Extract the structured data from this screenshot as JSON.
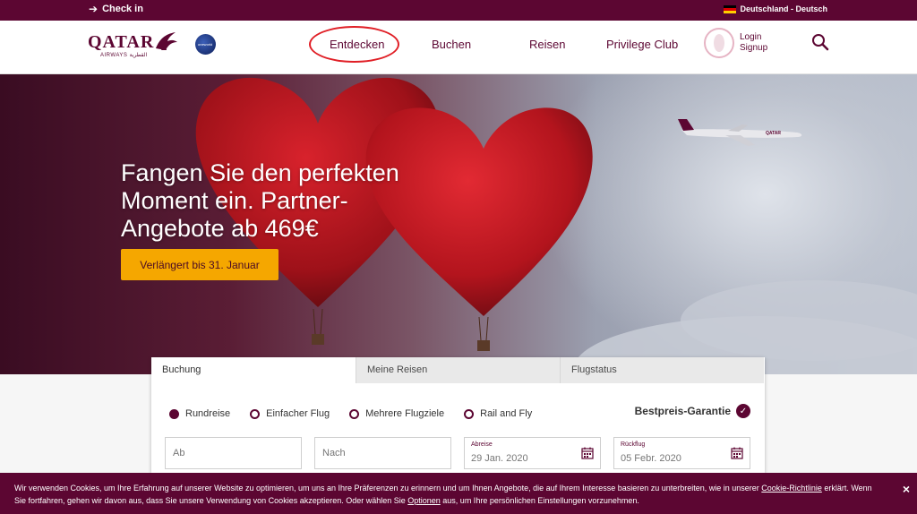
{
  "topbar": {
    "checkin": "Check in",
    "language": "Deutschland - Deutsch"
  },
  "nav": {
    "logo_text": "QATAR",
    "logo_sub": "AIRWAYS القطرية",
    "oneworld": "oneworld",
    "links": [
      "Entdecken",
      "Buchen",
      "Reisen",
      "Privilege Club"
    ],
    "login": "Login",
    "signup": "Signup"
  },
  "hero": {
    "title": "Fangen Sie den perfekten Moment ein. Partner-Angebote ab 469€",
    "cta": "Verlängert bis 31. Januar",
    "plane_livery": "QATAR"
  },
  "booking": {
    "tabs": [
      "Buchung",
      "Meine Reisen",
      "Flugstatus"
    ],
    "trip_types": [
      "Rundreise",
      "Einfacher Flug",
      "Mehrere Flugziele",
      "Rail and Fly"
    ],
    "selected_trip_type": "Rundreise",
    "best_price": "Bestpreis-Garantie",
    "from_placeholder": "Ab",
    "to_placeholder": "Nach",
    "departure_label": "Abreise",
    "departure_value": "29 Jan. 2020",
    "return_label": "Rückflug",
    "return_value": "05 Febr. 2020"
  },
  "cookie": {
    "part1": "Wir verwenden Cookies, um Ihre Erfahrung auf unserer Website zu optimieren, um uns an Ihre Präferenzen zu erinnern und um Ihnen Angebote, die auf Ihrem Interesse basieren zu unterbreiten, wie in unserer ",
    "link1": "Cookie-Richtlinie",
    "part2": " erklärt. Wenn Sie fortfahren, gehen wir davon aus, dass Sie unsere Verwendung von Cookies akzeptieren. Oder wählen Sie ",
    "link2": "Optionen",
    "part3": " aus, um Ihre persönlichen Einstellungen vorzunehmen.",
    "close": "×"
  },
  "colors": {
    "brand": "#5c0632",
    "cta": "#f5a700",
    "highlight": "#e01f26"
  }
}
